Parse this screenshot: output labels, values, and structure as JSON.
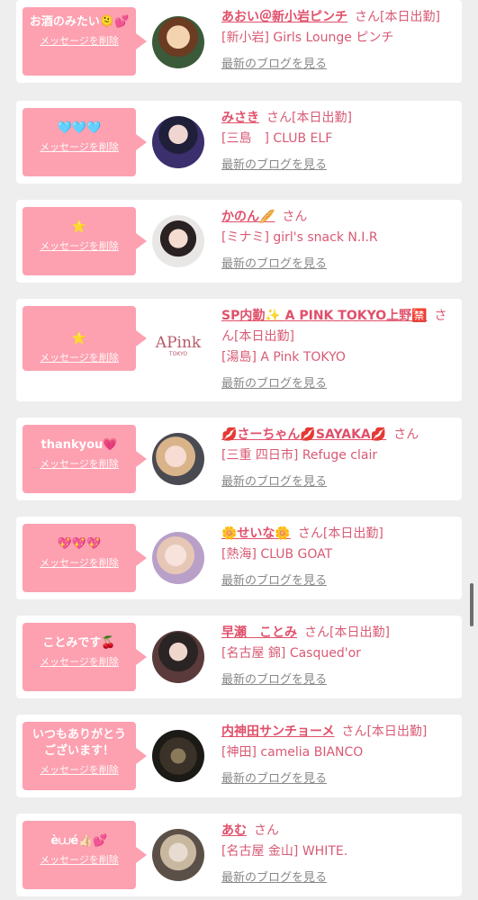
{
  "cards": [
    {
      "message": "お酒のみたい🫠💕",
      "delete_label": "メッセージを削除",
      "name": "あおい＠新小岩ピンチ",
      "suffix": "さん[本日出勤]",
      "shop": "[新小岩] Girls Lounge ピンチ",
      "blog_label": "最新のブログを見る"
    },
    {
      "message": "🩵🩵🩵",
      "delete_label": "メッセージを削除",
      "name": "みさき",
      "suffix": "さん[本日出勤]",
      "shop": "[三島　] CLUB ELF",
      "blog_label": "最新のブログを見る"
    },
    {
      "message": "⭐",
      "delete_label": "メッセージを削除",
      "name": "かのん🥖",
      "suffix": "さん",
      "shop": "[ミナミ] girl's snack N.I.R",
      "blog_label": "最新のブログを見る"
    },
    {
      "message": "⭐",
      "delete_label": "メッセージを削除",
      "name": "SP内勤✨ A PINK TOKYO上野🈲",
      "suffix": "さん[本日出勤]",
      "shop": "[湯島] A Pink TOKYO",
      "blog_label": "最新のブログを見る"
    },
    {
      "message": "thankyou💗",
      "delete_label": "メッセージを削除",
      "name": "💋さーちゃん💋SAYAKA💋",
      "suffix": "さん",
      "shop": "[三重 四日市] Refuge clair",
      "blog_label": "最新のブログを見る"
    },
    {
      "message": "💖💖💖",
      "delete_label": "メッセージを削除",
      "name": "🌼せいな🌼",
      "suffix": "さん[本日出勤]",
      "shop": "[熱海] CLUB GOAT",
      "blog_label": "最新のブログを見る"
    },
    {
      "message": "ことみです🍒",
      "delete_label": "メッセージを削除",
      "name": "早瀬　ことみ",
      "suffix": "さん[本日出勤]",
      "shop": "[名古屋 錦] Casqued'or",
      "blog_label": "最新のブログを見る"
    },
    {
      "message": "いつもありがとうございます！",
      "delete_label": "メッセージを削除",
      "name": "内神田サンチョーメ",
      "suffix": "さん[本日出勤]",
      "shop": "[神田] camelia BIANCO",
      "blog_label": "最新のブログを見る"
    },
    {
      "message": "è⩊é👍🏻💕",
      "delete_label": "メッセージを削除",
      "name": "あむ",
      "suffix": "さん",
      "shop": "[名古屋 金山] WHITE.",
      "blog_label": "最新のブログを見る"
    }
  ],
  "avatar3_logo_text": "APink",
  "avatar3_logo_sub": "TOKYO",
  "colors": {
    "bubble": "#fda0b0",
    "name": "#e0506a",
    "blog": "#888888"
  }
}
